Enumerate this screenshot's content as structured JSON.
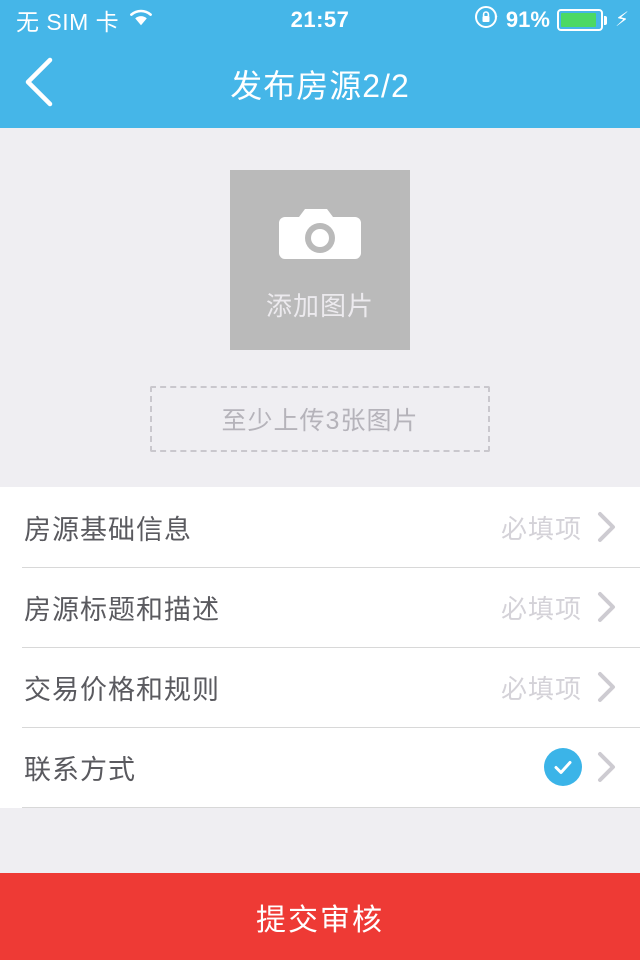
{
  "status_bar": {
    "carrier": "无 SIM 卡",
    "wifi_icon": "wifi-icon",
    "time": "21:57",
    "rotation_lock_icon": "rotation-lock-icon",
    "battery_percent": "91%",
    "battery_level": 91,
    "battery_icon": "battery-icon",
    "charging_icon": "charging-bolt-icon"
  },
  "nav": {
    "back_icon": "chevron-left-icon",
    "title": "发布房源2/2"
  },
  "upload": {
    "camera_icon": "camera-icon",
    "add_photo_label": "添加图片",
    "hint": "至少上传3张图片"
  },
  "list": {
    "rows": [
      {
        "label": "房源基础信息",
        "value": "必填项",
        "completed": false,
        "chevron_icon": "chevron-right-icon"
      },
      {
        "label": "房源标题和描述",
        "value": "必填项",
        "completed": false,
        "chevron_icon": "chevron-right-icon"
      },
      {
        "label": "交易价格和规则",
        "value": "必填项",
        "completed": false,
        "chevron_icon": "chevron-right-icon"
      },
      {
        "label": "联系方式",
        "value": "",
        "completed": true,
        "check_icon": "check-circle-icon",
        "chevron_icon": "chevron-right-icon"
      }
    ]
  },
  "submit": {
    "label": "提交审核"
  },
  "colors": {
    "brand_blue": "#45b6e8",
    "accent_blue": "#3bb4e8",
    "page_bg": "#efeef2",
    "photo_box": "#bababa",
    "submit_red": "#ee3a35",
    "battery_green": "#4cd964",
    "muted_text": "#d4d2d8"
  }
}
